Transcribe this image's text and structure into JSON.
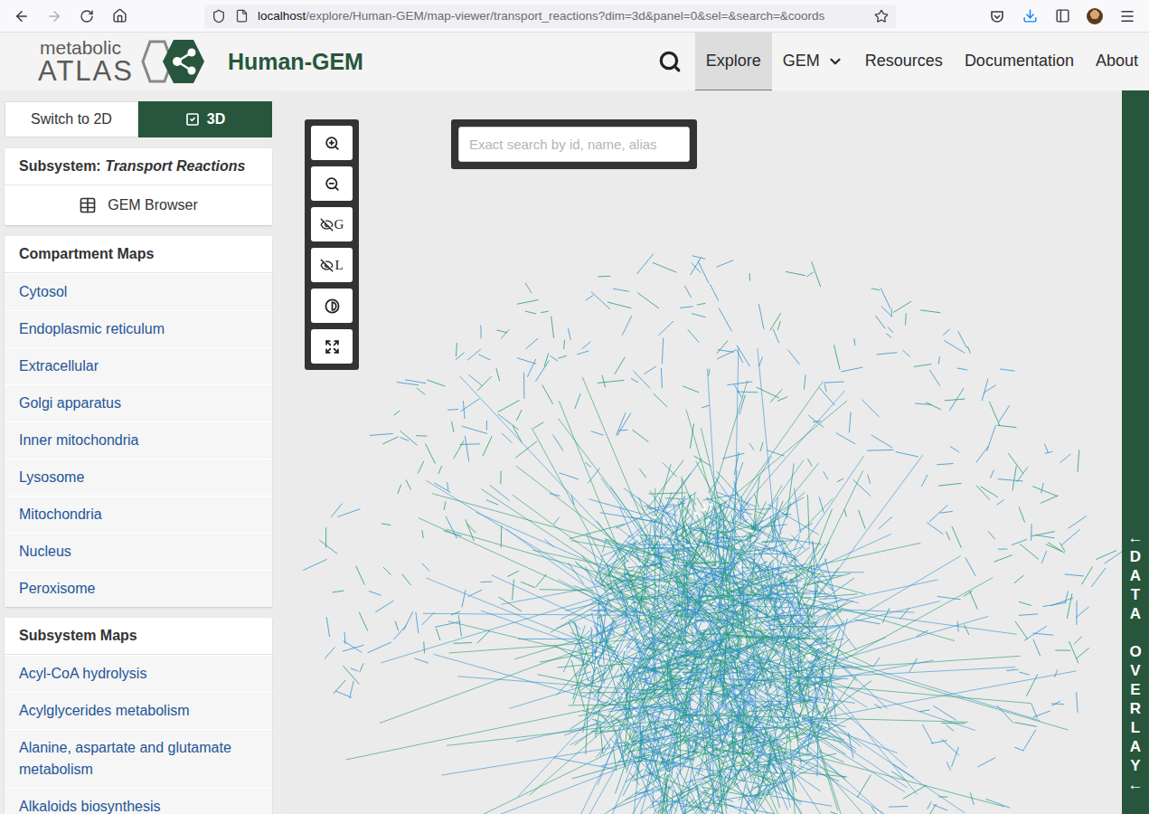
{
  "browser": {
    "url_host": "localhost",
    "url_path": "/explore/Human-GEM/map-viewer/transport_reactions?dim=3d&panel=0&sel=&search=&coords"
  },
  "header": {
    "logo_top": "metabolic",
    "logo_bottom": "ATLAS",
    "model": "Human-GEM",
    "nav": [
      {
        "label": "Explore",
        "selected": true,
        "dropdown": false
      },
      {
        "label": "GEM",
        "selected": false,
        "dropdown": true
      },
      {
        "label": "Resources",
        "selected": false,
        "dropdown": false
      },
      {
        "label": "Documentation",
        "selected": false,
        "dropdown": false
      },
      {
        "label": "About",
        "selected": false,
        "dropdown": false
      }
    ]
  },
  "sidebar": {
    "view_toggle": [
      {
        "label": "Switch to 2D",
        "selected": false
      },
      {
        "label": "3D",
        "selected": true
      }
    ],
    "subsystem": {
      "prefix": "Subsystem:",
      "name": "Transport Reactions"
    },
    "gem_browser": "GEM Browser",
    "sections": [
      {
        "title": "Compartment Maps",
        "items": [
          "Cytosol",
          "Endoplasmic reticulum",
          "Extracellular",
          "Golgi apparatus",
          "Inner mitochondria",
          "Lysosome",
          "Mitochondria",
          "Nucleus",
          "Peroxisome"
        ]
      },
      {
        "title": "Subsystem Maps",
        "items": [
          "Acyl-CoA hydrolysis",
          "Acylglycerides metabolism",
          "Alanine, aspartate and glutamate metabolism",
          "Alkaloids biosynthesis"
        ]
      }
    ]
  },
  "map": {
    "tools": [
      {
        "kind": "zoom-in",
        "label": ""
      },
      {
        "kind": "zoom-out",
        "label": ""
      },
      {
        "kind": "toggle",
        "label": "G"
      },
      {
        "kind": "toggle",
        "label": "L"
      },
      {
        "kind": "contrast",
        "label": ""
      },
      {
        "kind": "fullscreen",
        "label": ""
      }
    ],
    "search": {
      "placeholder": "Exact search by id, name, alias"
    }
  },
  "overlay_toggle": {
    "label": "DATA OVERLAY",
    "arrow": "←"
  }
}
